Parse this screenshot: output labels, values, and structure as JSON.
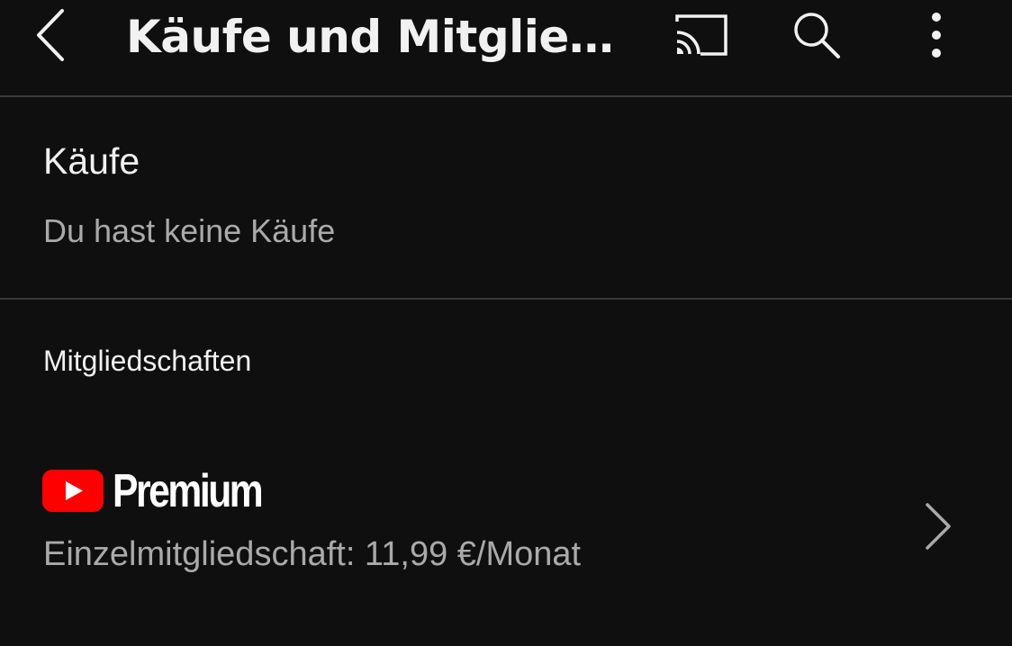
{
  "header": {
    "title": "Käufe und Mitglie…",
    "back_icon": "chevron-left-icon",
    "cast_icon": "cast-icon",
    "search_icon": "search-icon",
    "more_icon": "more-vertical-icon"
  },
  "purchases": {
    "title": "Käufe",
    "empty_text": "Du hast keine Käufe"
  },
  "memberships": {
    "label": "Mitgliedschaften",
    "items": [
      {
        "brand": "Premium",
        "detail": "Einzelmitgliedschaft: 11,99 €/Monat",
        "logo_icon": "youtube-play-icon",
        "chevron_icon": "chevron-right-icon"
      }
    ]
  },
  "colors": {
    "background": "#0f0f0f",
    "text_primary": "#f1f1f1",
    "text_secondary": "#aaaaaa",
    "divider": "#3a3a3a",
    "youtube_red": "#ff0000"
  }
}
